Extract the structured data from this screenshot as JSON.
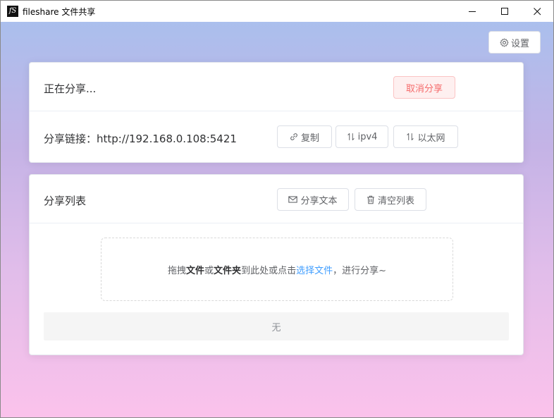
{
  "window": {
    "title": "fileshare 文件共享",
    "icon_glyph": "fS"
  },
  "toolbar": {
    "settings_label": "设置"
  },
  "share_card": {
    "status_text": "正在分享...",
    "cancel_label": "取消分享",
    "link_label": "分享链接：",
    "link_value": "http://192.168.0.108:5421",
    "copy_label": "复制",
    "ipv4_label": "ipv4",
    "network_label": "以太网"
  },
  "list_card": {
    "title": "分享列表",
    "share_text_label": "分享文本",
    "clear_label": "清空列表",
    "drop_prefix": "拖拽",
    "drop_file": "文件",
    "drop_or": "或",
    "drop_folder": "文件夹",
    "drop_middle": "到此处或点击",
    "drop_link": "选择文件",
    "drop_suffix": "，进行分享~",
    "empty_text": "无"
  },
  "colors": {
    "danger": "#f56c6c",
    "link": "#409eff",
    "gradient_top": "#a6c1ee",
    "gradient_bottom": "#fbc2eb"
  }
}
